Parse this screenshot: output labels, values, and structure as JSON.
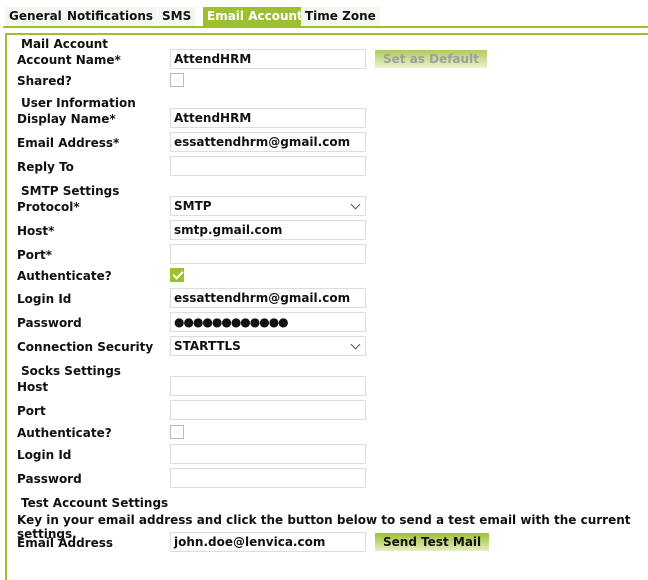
{
  "tabs": [
    "General",
    "Notifications",
    "SMS",
    "Email Accounts",
    "Time Zone"
  ],
  "active_tab": "Email Accounts",
  "accent_color": "#9dc02e",
  "mail_account": {
    "heading": "Mail Account",
    "account_name_label": "Account Name*",
    "account_name": "AttendHRM",
    "set_default_label": "Set as Default",
    "shared_label": "Shared?",
    "shared": false
  },
  "user_info": {
    "heading": "User Information",
    "display_name_label": "Display Name*",
    "display_name": "AttendHRM",
    "email_label": "Email Address*",
    "email": "essattendhrm@gmail.com",
    "reply_to_label": "Reply To",
    "reply_to": ""
  },
  "smtp": {
    "heading": "SMTP Settings",
    "protocol_label": "Protocol*",
    "protocol": "SMTP",
    "host_label": "Host*",
    "host": "smtp.gmail.com",
    "port_label": "Port*",
    "port": "",
    "auth_label": "Authenticate?",
    "auth": true,
    "login_label": "Login Id",
    "login": "essattendhrm@gmail.com",
    "password_label": "Password",
    "password": "●●●●●●●●●●●●",
    "security_label": "Connection Security",
    "security": "STARTTLS"
  },
  "socks": {
    "heading": "Socks Settings",
    "host_label": "Host",
    "host": "",
    "port_label": "Port",
    "port": "",
    "auth_label": "Authenticate?",
    "auth": false,
    "login_label": "Login Id",
    "login": "",
    "password_label": "Password",
    "password": ""
  },
  "test": {
    "heading": "Test Account Settings",
    "instructions": "Key in your email address and click the button below to send a test email with the current settings.",
    "email_label": "Email Address",
    "email": "john.doe@lenvica.com",
    "send_label": "Send Test Mail"
  }
}
